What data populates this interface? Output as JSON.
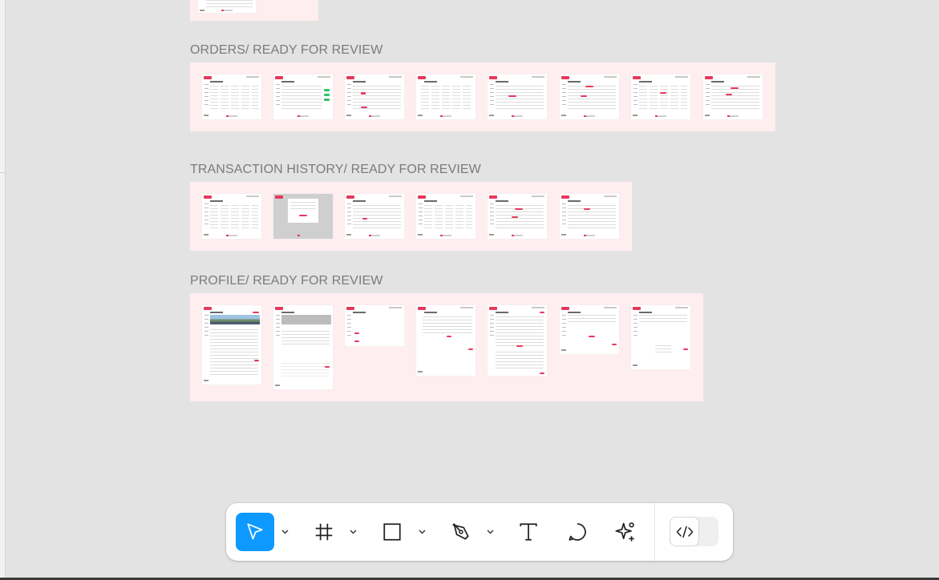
{
  "canvas": {
    "sections": [
      {
        "id": "orders",
        "label": "ORDERS/ READY FOR REVIEW",
        "frame_count": 8
      },
      {
        "id": "transaction-history",
        "label": "TRANSACTION HISTORY/ READY FOR REVIEW",
        "frame_count": 6
      },
      {
        "id": "profile",
        "label": "PROFILE/ READY FOR REVIEW",
        "frame_count": 7
      }
    ]
  },
  "toolbar": {
    "tools": [
      {
        "name": "move",
        "icon": "cursor-arrow-icon",
        "active": true
      },
      {
        "name": "frame",
        "icon": "frame-hash-icon",
        "active": false
      },
      {
        "name": "shape",
        "icon": "rectangle-icon",
        "active": false
      },
      {
        "name": "pen",
        "icon": "pen-nib-icon",
        "active": false
      },
      {
        "name": "text",
        "icon": "text-t-icon",
        "active": false
      },
      {
        "name": "comment",
        "icon": "speech-bubble-icon",
        "active": false
      },
      {
        "name": "actions",
        "icon": "sparkle-icon",
        "active": false
      }
    ],
    "dev_mode": {
      "icon": "code-brackets-icon",
      "enabled": false
    }
  },
  "colors": {
    "canvas_bg": "#e3e3e3",
    "section_bg": "#ffeef0",
    "accent": "#e6385d",
    "tool_active": "#0d99ff"
  }
}
